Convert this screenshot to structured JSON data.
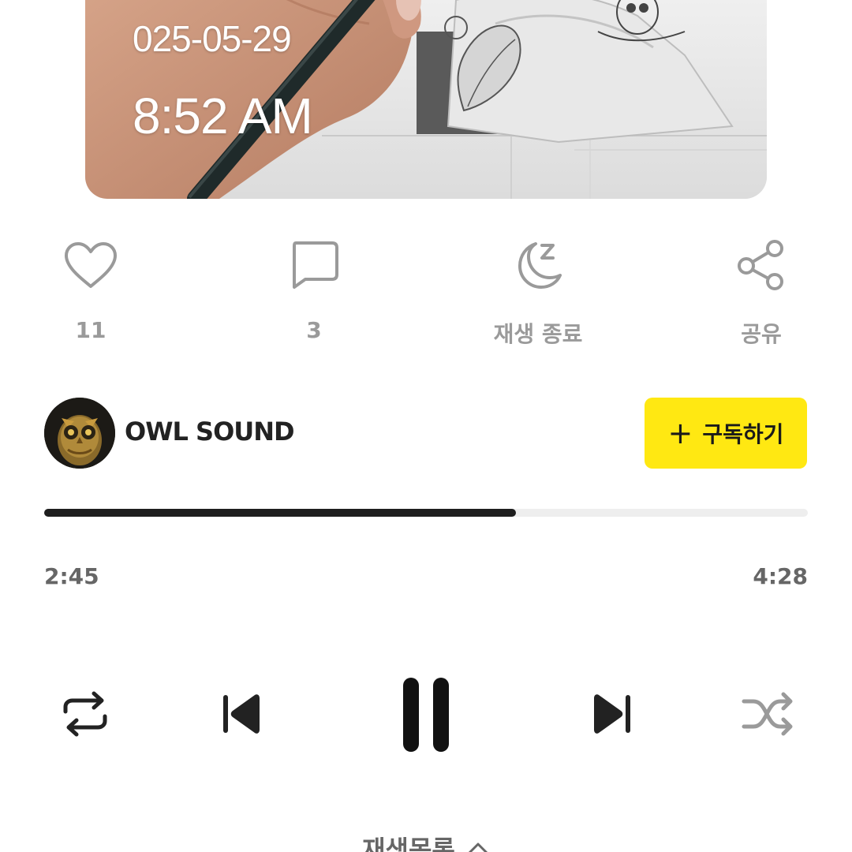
{
  "artwork": {
    "date": "025-05-29",
    "time": "8:52 AM"
  },
  "actions": {
    "like": {
      "label": "11",
      "icon": "heart-icon"
    },
    "comment": {
      "label": "3",
      "icon": "comment-icon"
    },
    "sleep_timer": {
      "label": "재생 종료",
      "icon": "moon-sleep-icon"
    },
    "share": {
      "label": "공유",
      "icon": "share-icon"
    }
  },
  "channel": {
    "name": "OWL SOUND",
    "subscribe_label": "구독하기"
  },
  "playback": {
    "current_time": "2:45",
    "total_time": "4:28",
    "progress": 0.618
  },
  "controls": {
    "repeat": "repeat-icon",
    "previous": "previous-icon",
    "pause": "pause-icon",
    "next": "next-icon",
    "shuffle": "shuffle-icon"
  },
  "playlist": {
    "label": "재생목록"
  },
  "colors": {
    "accent_yellow": "#ffe812",
    "progress_fill": "#1e1e1e",
    "progress_track": "#eeeeee",
    "icon_gray": "#9a9a9a"
  }
}
